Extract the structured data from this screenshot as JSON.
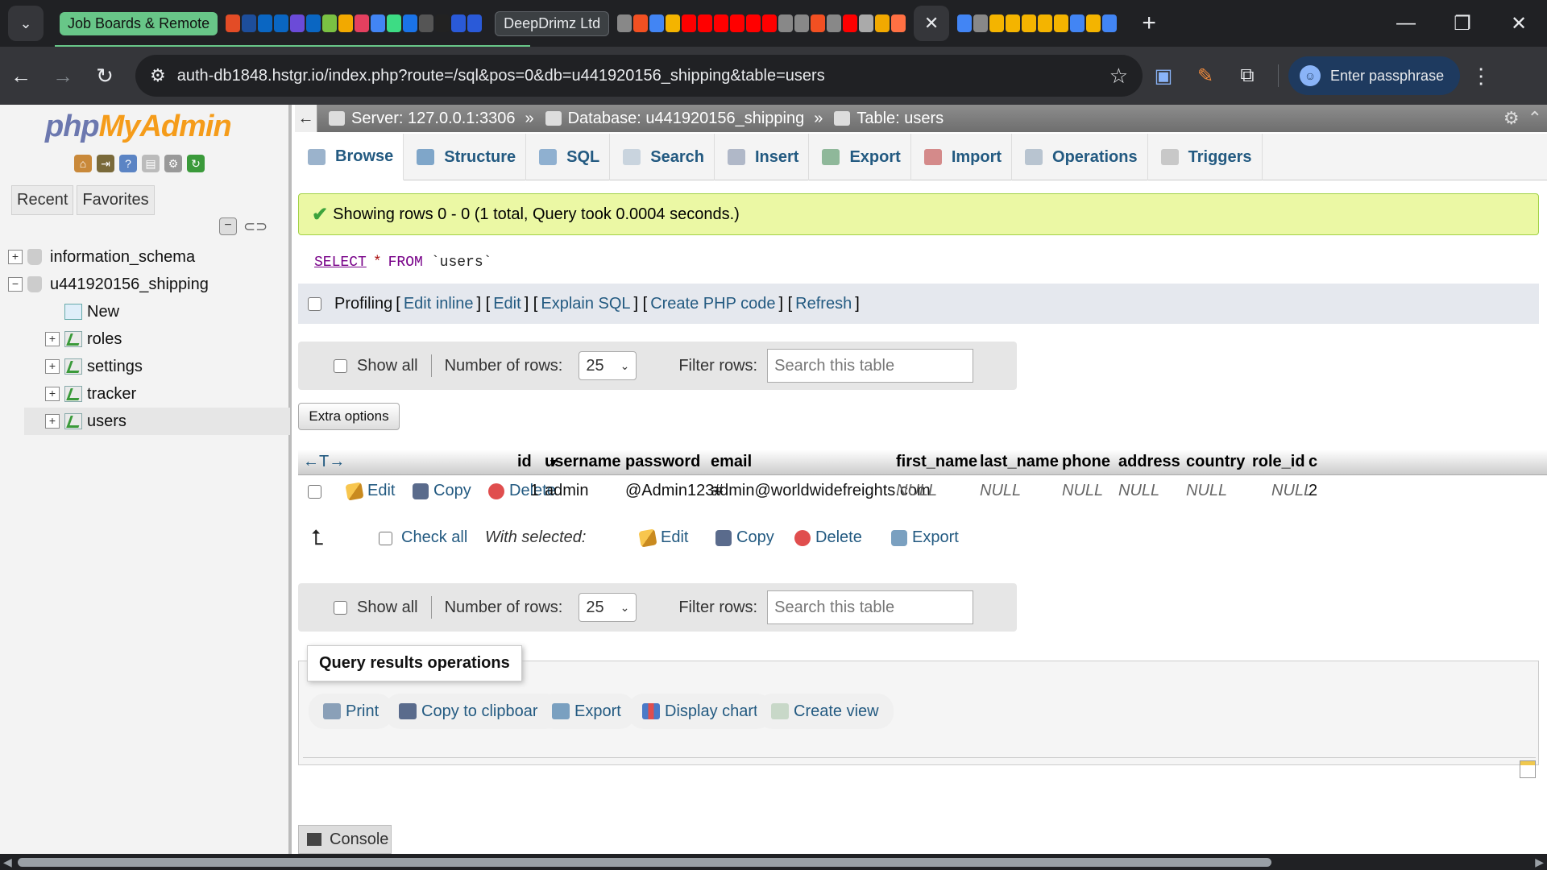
{
  "browser": {
    "tab_groups": [
      "Job Boards & Remote",
      "DeepDrimz Ltd"
    ],
    "favicon_colors_1": [
      "#e34c26",
      "#1d4e9b",
      "#0a66c2",
      "#0a66c2",
      "#6b4bd8",
      "#0a66c2",
      "#7ac143",
      "#f2a900",
      "#e4405f",
      "#4285f4",
      "#3ddc84",
      "#1a73e8",
      "#555555",
      "#222222",
      "#2a5ad8",
      "#2a5ad8"
    ],
    "favicon_colors_2": [
      "#888888",
      "#f25022",
      "#4285f4",
      "#f4b400",
      "#ff0000",
      "#ff0000",
      "#ff0000",
      "#ff0000",
      "#ff0000",
      "#ff0000",
      "#888888",
      "#888888",
      "#f25022",
      "#888888",
      "#ff0000",
      "#aaaaaa",
      "#f2a900",
      "#ff7043"
    ],
    "favicon_colors_3": [
      "#4285f4",
      "#888888",
      "#f4b400",
      "#f4b400",
      "#f4b400",
      "#f4b400",
      "#f4b400",
      "#4285f4",
      "#f4b400",
      "#4285f4"
    ],
    "active_tab_close": "✕",
    "new_tab": "+",
    "url": "auth-db1848.hstgr.io/index.php?route=/sql&pos=0&db=u441920156_shipping&table=users",
    "passphrase_button": "Enter passphrase",
    "accent_color": "#68c688"
  },
  "nav": {
    "logo_php": "php",
    "logo_my": "My",
    "logo_admin": "Admin",
    "tabs": [
      "Recent",
      "Favorites"
    ],
    "tree": [
      {
        "label": "information_schema",
        "level": 0,
        "type": "db",
        "expander": "+"
      },
      {
        "label": "u441920156_shipping",
        "level": 0,
        "type": "db",
        "expander": "−"
      },
      {
        "label": "New",
        "level": 1,
        "type": "new"
      },
      {
        "label": "roles",
        "level": 1,
        "type": "table",
        "expander": "+"
      },
      {
        "label": "settings",
        "level": 1,
        "type": "table",
        "expander": "+"
      },
      {
        "label": "tracker",
        "level": 1,
        "type": "table",
        "expander": "+"
      },
      {
        "label": "users",
        "level": 1,
        "type": "table",
        "expander": "+",
        "selected": true
      }
    ]
  },
  "breadcrumb": {
    "server": "Server: 127.0.0.1:3306",
    "database": "Database: u441920156_shipping",
    "table": "Table: users",
    "sep": "»"
  },
  "tabs": [
    "Browse",
    "Structure",
    "SQL",
    "Search",
    "Insert",
    "Export",
    "Import",
    "Operations",
    "Triggers"
  ],
  "message": "Showing rows 0 - 0 (1 total, Query took 0.0004 seconds.)",
  "sql": {
    "select": "SELECT",
    "star": "*",
    "from": "FROM",
    "table": "`users`"
  },
  "profiling": {
    "label": "Profiling",
    "links": [
      "Edit inline",
      "Edit",
      "Explain SQL",
      "Create PHP code",
      "Refresh"
    ]
  },
  "rows_bar": {
    "show_all": "Show all",
    "number_of_rows_label": "Number of rows:",
    "number_of_rows_value": "25",
    "filter_label": "Filter rows:",
    "filter_placeholder": "Search this table"
  },
  "extra_options": "Extra options",
  "table": {
    "sort_arrows": "←T→",
    "columns": [
      "id",
      "username",
      "password",
      "email",
      "first_name",
      "last_name",
      "phone",
      "address",
      "country",
      "role_id",
      "c"
    ],
    "row_actions": [
      "Edit",
      "Copy",
      "Delete"
    ],
    "rows": [
      {
        "id": "1",
        "username": "admin",
        "password": "@Admin123#",
        "email": "admin@worldwidefreights.com",
        "first_name": "NULL",
        "last_name": "NULL",
        "phone": "NULL",
        "address": "NULL",
        "country": "NULL",
        "role_id": "NULL",
        "c": "2"
      }
    ]
  },
  "with_selected": {
    "check_all": "Check all",
    "label": "With selected:",
    "actions": [
      "Edit",
      "Copy",
      "Delete",
      "Export"
    ]
  },
  "query_ops": {
    "legend": "Query results operations",
    "buttons": [
      "Print",
      "Copy to clipboard",
      "Export",
      "Display chart",
      "Create view"
    ]
  },
  "console": "Console"
}
